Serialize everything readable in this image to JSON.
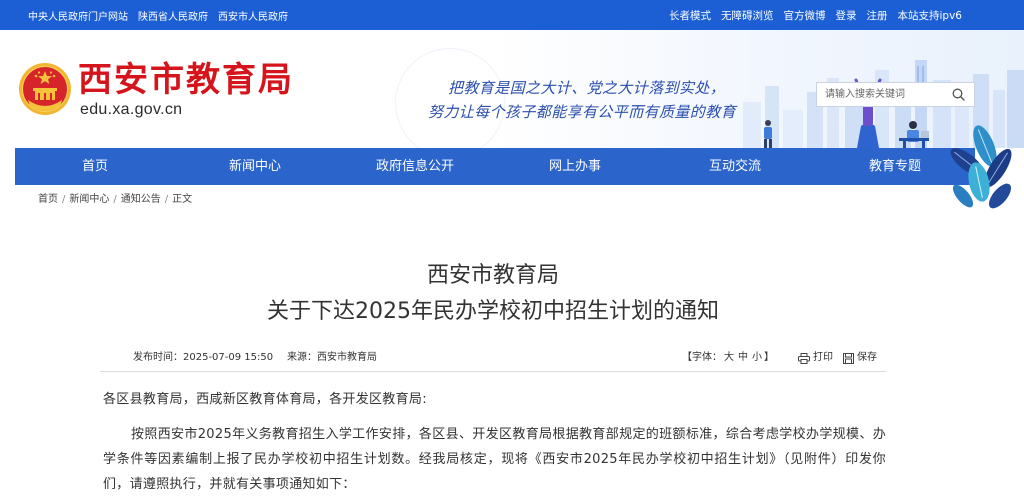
{
  "top_bar": {
    "left_links": [
      "中央人民政府门户网站",
      "陕西省人民政府",
      "西安市人民政府"
    ],
    "right_links": [
      "长者模式",
      "无障碍浏览",
      "官方微博",
      "登录",
      "注册",
      "本站支持ipv6"
    ]
  },
  "header": {
    "site_name": "西安市教育局",
    "domain": "edu.xa.gov.cn",
    "slogan": [
      "把教育是国之大计、党之大计落到实处，",
      "努力让每个孩子都能享有公平而有质量的教育"
    ],
    "search": {
      "placeholder": "请输入搜索关键词"
    }
  },
  "nav": [
    "首页",
    "新闻中心",
    "政府信息公开",
    "网上办事",
    "互动交流",
    "教育专题"
  ],
  "breadcrumb": {
    "items": [
      "首页",
      "新闻中心",
      "通知公告",
      "正文"
    ],
    "separator": "/"
  },
  "article": {
    "title": [
      "西安市教育局",
      "关于下达2025年民办学校初中招生计划的通知"
    ],
    "publish_label": "发布时间：",
    "publish_time": "2025-07-09 15:50",
    "source_label": "来源：",
    "source": "西安市教育局",
    "font_size": {
      "open": "【字体：",
      "large": "大",
      "medium": "中",
      "small": "小",
      "close": "】"
    },
    "print_label": "打印",
    "save_label": "保存",
    "salutation": "各区县教育局，西咸新区教育体育局，各开发区教育局:",
    "paragraphs": [
      "按照西安市2025年义务教育招生入学工作安排，各区县、开发区教育局根据教育部规定的班额标准，综合考虑学校办学规模、办学条件等因素编制上报了民办学校初中招生计划数。经我局核定，现将《西安市2025年民办学校初中招生计划》（见附件）印发你们，请遵照执行，并就有关事项通知如下："
    ]
  },
  "icons": {
    "emblem": "national-emblem-icon",
    "search": "search-icon",
    "print": "printer-icon",
    "save": "save-icon"
  },
  "colors": {
    "top_bar": "#1c5fd4",
    "nav": "#2b64cb",
    "brand_red": "#d5141b",
    "slogan": "#2a4fae",
    "text": "#333333"
  }
}
